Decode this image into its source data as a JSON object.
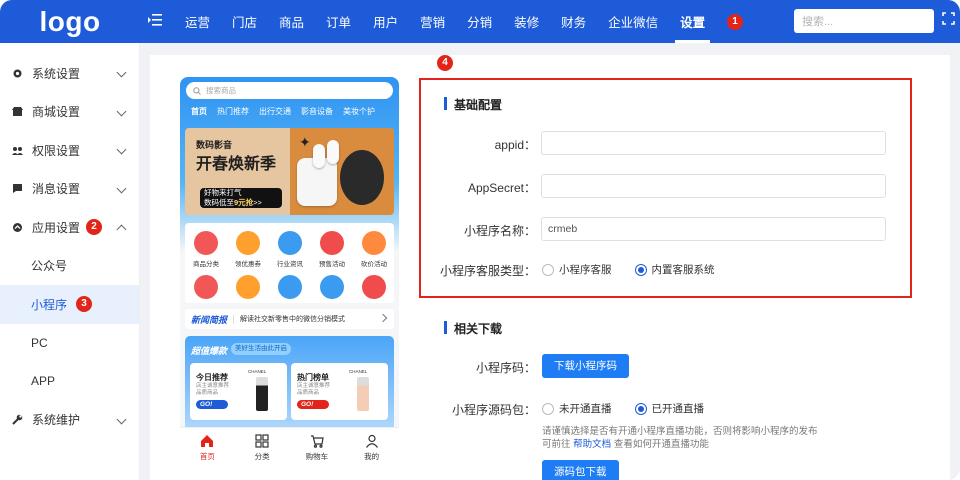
{
  "header": {
    "logo": "logo",
    "nav": [
      "运营",
      "门店",
      "商品",
      "订单",
      "用户",
      "营销",
      "分销",
      "装修",
      "财务",
      "企业微信",
      "设置"
    ],
    "active_nav": "设置",
    "search_placeholder": "搜索...",
    "nav_badge": "1"
  },
  "sidebar": {
    "items": [
      {
        "label": "系统设置",
        "icon": "gear-icon"
      },
      {
        "label": "商城设置",
        "icon": "store-icon"
      },
      {
        "label": "权限设置",
        "icon": "users-icon"
      },
      {
        "label": "消息设置",
        "icon": "message-icon"
      },
      {
        "label": "应用设置",
        "icon": "app-icon",
        "badge": "2",
        "expanded": true
      },
      {
        "label": "系统维护",
        "icon": "wrench-icon"
      }
    ],
    "sub_items": [
      "公众号",
      "小程序",
      "PC",
      "APP"
    ],
    "active_sub": "小程序",
    "sub_badge": "3"
  },
  "phone": {
    "search_placeholder": "搜索商品",
    "tabs": [
      "首页",
      "热门推荐",
      "出行交通",
      "影音设备",
      "美妆个护"
    ],
    "banner": {
      "sub": "数码影音",
      "title": "开春焕新季",
      "tag1": "好物来打气",
      "tag2": "数码低至",
      "tag_price": "9元抢",
      "tag_more": ">>"
    },
    "categories": [
      "商品分类",
      "领优惠券",
      "行业资讯",
      "预售活动",
      "砍价活动"
    ],
    "news_title": "新闻简报",
    "news_text": "解读社交新零售中的微信分销模式",
    "deals_title": "超值爆款",
    "deals_sub": "美好生活由此开启",
    "deal_cards": [
      {
        "title": "今日推荐",
        "desc": "店主诚意推荐 品质商品",
        "go": "GO!",
        "brand": "CHANEL"
      },
      {
        "title": "热门榜单",
        "desc": "店主诚意推荐 品质商品",
        "go": "GO!",
        "brand": "CHANEL"
      }
    ],
    "tabbar": [
      "首页",
      "分类",
      "购物车",
      "我的"
    ]
  },
  "config": {
    "box_badge": "4",
    "basic_title": "基础配置",
    "appid_label": "appid：",
    "appid_value": "",
    "appsecret_label": "AppSecret：",
    "appsecret_value": "",
    "name_label": "小程序名称：",
    "name_value": "crmeb",
    "service_label": "小程序客服类型：",
    "service_options": [
      "小程序客服",
      "内置客服系统"
    ],
    "service_selected": "内置客服系统",
    "download_title": "相关下载",
    "qrcode_label": "小程序码：",
    "qrcode_button": "下载小程序码",
    "source_label": "小程序源码包：",
    "live_options": [
      "未开通直播",
      "已开通直播"
    ],
    "live_selected": "已开通直播",
    "hint_line1": "请谨慎选择是否有开通小程序直播功能，否则将影响小程序的发布",
    "hint_prefix": "可前往",
    "hint_link": "帮助文档",
    "hint_suffix": "查看如何开通直播功能",
    "source_button": "源码包下载"
  },
  "colors": {
    "primary": "#1e5bd8",
    "badge": "#e1251b",
    "highlight_border": "#e1251b"
  }
}
